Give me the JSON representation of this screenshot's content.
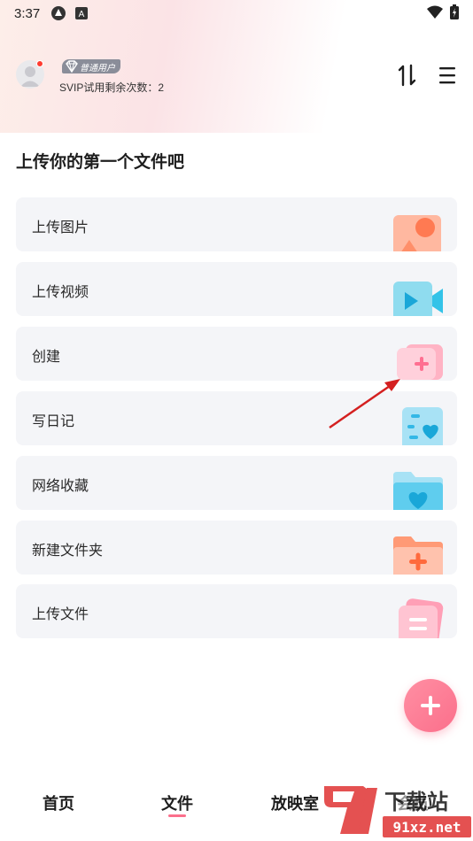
{
  "status_bar": {
    "time": "3:37"
  },
  "header": {
    "badge_label": "普通用户",
    "svip_text": "SVIP试用剩余次数：2"
  },
  "page_title": "上传你的第一个文件吧",
  "cards": [
    {
      "label": "上传图片",
      "icon": "image-icon"
    },
    {
      "label": "上传视频",
      "icon": "video-icon"
    },
    {
      "label": "创建",
      "icon": "create-plus-icon"
    },
    {
      "label": "写日记",
      "icon": "diary-heart-icon"
    },
    {
      "label": "网络收藏",
      "icon": "favorite-folder-icon"
    },
    {
      "label": "新建文件夹",
      "icon": "new-folder-icon"
    },
    {
      "label": "上传文件",
      "icon": "file-icon"
    }
  ],
  "bottom_nav": [
    {
      "label": "首页",
      "active": false
    },
    {
      "label": "文件",
      "active": true
    },
    {
      "label": "放映室",
      "active": false
    },
    {
      "label": "会员",
      "active": false
    }
  ],
  "watermark": {
    "brand_top": "下载站",
    "brand_bottom": "91xz.net",
    "logo": "91"
  },
  "colors": {
    "accent": "#fb6f8b",
    "card_bg": "#f4f5f8"
  }
}
